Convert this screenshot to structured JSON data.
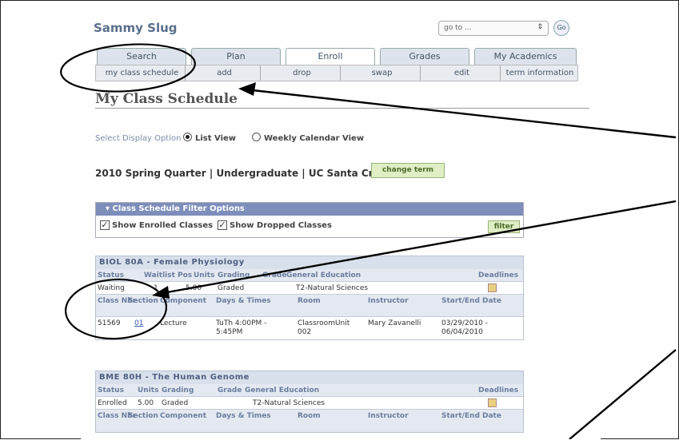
{
  "header": {
    "user_name": "Sammy Slug",
    "goto_placeholder": "go to ...",
    "go_button": "Go"
  },
  "tabs": [
    "Search",
    "Plan",
    "Enroll",
    "Grades",
    "My Academics"
  ],
  "subtabs": [
    "my class schedule",
    "add",
    "drop",
    "swap",
    "edit",
    "term information"
  ],
  "page_title": "My Class Schedule",
  "display": {
    "label": "Select Display Option",
    "options": [
      "List View",
      "Weekly Calendar View"
    ],
    "selected": "List View"
  },
  "term": {
    "text": "2010 Spring Quarter | Undergraduate | UC Santa Cruz",
    "change_button": "change term"
  },
  "filter": {
    "title": "Class Schedule Filter Options",
    "checks": [
      "Show Enrolled Classes",
      "Show Dropped Classes"
    ],
    "button": "filter"
  },
  "courses": [
    {
      "title": "BIOL 80A - Female Physiology",
      "headers": [
        "Status",
        "Waitlist Pos",
        "Units",
        "Grading",
        "Grade",
        "General Education",
        "Deadlines"
      ],
      "values": [
        "Waiting",
        "1",
        "5.00",
        "Graded",
        "",
        "T2-Natural Sciences",
        ""
      ],
      "sec_headers": [
        "Class Nbr",
        "Section",
        "Component",
        "Days & Times",
        "Room",
        "Instructor",
        "Start/End Date"
      ],
      "sec_values": [
        "51569",
        "01",
        "Lecture",
        "TuTh 4:00PM - 5:45PM",
        "ClassroomUnit 002",
        "Mary Zavanelli",
        "03/29/2010 - 06/04/2010"
      ]
    },
    {
      "title": "BME 80H - The Human Genome",
      "headers": [
        "Status",
        "Units",
        "Grading",
        "Grade",
        "General Education",
        "Deadlines"
      ],
      "values": [
        "Enrolled",
        "5.00",
        "Graded",
        "",
        "T2-Natural Sciences",
        ""
      ],
      "sec_headers": [
        "Class Nbr",
        "Section",
        "Component",
        "Days & Times",
        "Room",
        "Instructor",
        "Start/End Date"
      ]
    }
  ]
}
